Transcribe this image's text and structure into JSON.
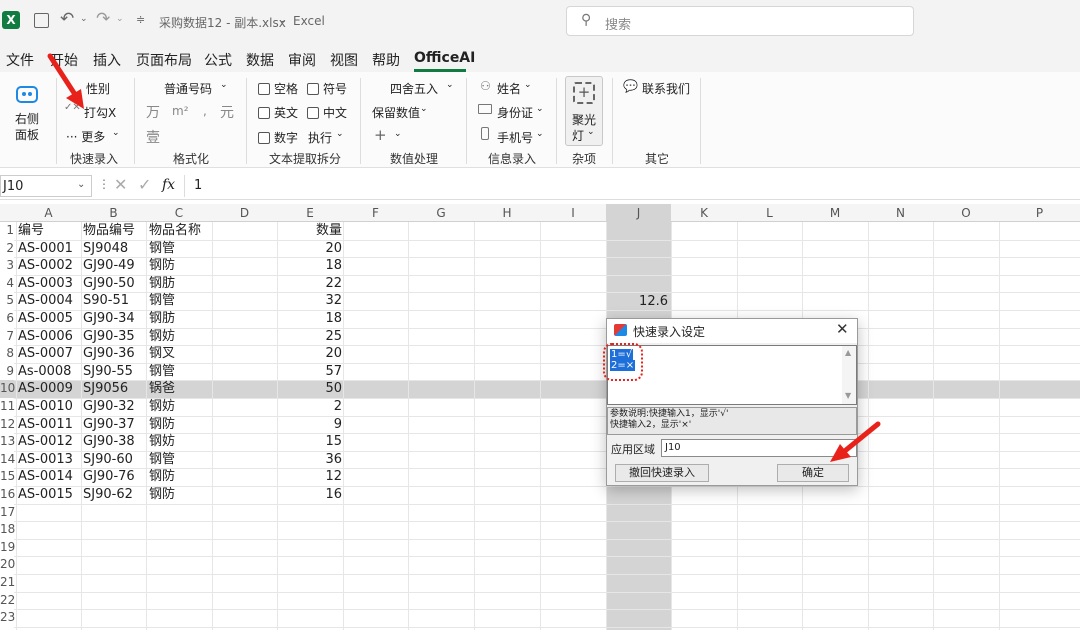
{
  "app": {
    "doc_title": "采购数据12 - 副本.xlsx",
    "separator": "-",
    "app_name": "Excel",
    "search_placeholder": "搜索",
    "logo_letter": "X"
  },
  "menu": [
    "文件",
    "开始",
    "插入",
    "页面布局",
    "公式",
    "数据",
    "审阅",
    "视图",
    "帮助",
    "OfficeAI"
  ],
  "ribbon": {
    "panel": {
      "line1": "右侧",
      "line2": "面板"
    },
    "quick": {
      "gender": "性别",
      "tick": "打勾X",
      "more": "··· 更多",
      "group": "快速录入"
    },
    "format": {
      "dropdown": "普通号码",
      "u1": "万",
      "u2": "m²",
      "u3": ",",
      "u4": "元",
      "u5": "壹",
      "group": "格式化"
    },
    "text": {
      "c1": "空格",
      "c2": "符号",
      "c3": "英文",
      "c4": "中文",
      "c5": "数字",
      "exec": "执行",
      "group": "文本提取拆分"
    },
    "number": {
      "round": "四舍五入",
      "keep": "保留数值",
      "plus": "+",
      "group": "数值处理"
    },
    "info": {
      "name": "姓名",
      "id": "身份证",
      "phone": "手机号",
      "group": "信息录入"
    },
    "misc": {
      "line1": "聚光",
      "line2": "灯",
      "group": "杂项"
    },
    "other": {
      "contact": "联系我们",
      "group": "其它"
    }
  },
  "formula": {
    "namebox": "J10",
    "fx": "fx",
    "value": "1"
  },
  "columns": [
    "A",
    "B",
    "C",
    "D",
    "E",
    "F",
    "G",
    "H",
    "I",
    "J",
    "K",
    "L",
    "M",
    "N",
    "O",
    "P"
  ],
  "row_numbers": [
    "1",
    "2",
    "3",
    "4",
    "5",
    "6",
    "7",
    "8",
    "9",
    "10",
    "11",
    "12",
    "13",
    "14",
    "15",
    "16",
    "17",
    "18",
    "19",
    "20",
    "21",
    "22",
    "23"
  ],
  "table": {
    "headers": [
      "编号",
      "物品编号",
      "物品名称",
      "数量"
    ],
    "rows": [
      [
        "AS-0001",
        "SJ9048",
        "钢管",
        "20"
      ],
      [
        "AS-0002",
        "GJ90-49",
        "钢防",
        "18"
      ],
      [
        "AS-0003",
        "GJ90-50",
        "钢肪",
        "22"
      ],
      [
        "AS-0004",
        "S90-51",
        "钢管",
        "32"
      ],
      [
        "AS-0005",
        "GJ90-34",
        "钢肪",
        "18"
      ],
      [
        "AS-0006",
        "GJ90-35",
        "钢妨",
        "25"
      ],
      [
        "AS-0007",
        "GJ90-36",
        "钢叉",
        "20"
      ],
      [
        "As-0008",
        "SJ90-55",
        "钢管",
        "57"
      ],
      [
        "AS-0009",
        "SJ9056",
        "锅爸",
        "50"
      ],
      [
        "AS-0010",
        "GJ90-32",
        "钢妨",
        "2"
      ],
      [
        "AS-0011",
        "GJ90-37",
        "钢防",
        "9"
      ],
      [
        "AS-0012",
        "GJ90-38",
        "钢妨",
        "15"
      ],
      [
        "AS-0013",
        "SJ90-60",
        "钢管",
        "36"
      ],
      [
        "AS-0014",
        "GJ90-76",
        "钢防",
        "12"
      ],
      [
        "AS-0015",
        "SJ90-62",
        "钢防",
        "16"
      ]
    ]
  },
  "j_cell_value": "12.6",
  "dialog": {
    "title": "快速录入设定",
    "line1": "1=√",
    "line2": "2=×",
    "help1": "参数说明:快捷输入1，显示'√'",
    "help2": "快捷输入2，显示'×'",
    "area_label": "应用区域",
    "area_value": "J10",
    "undo": "撤回快速录入",
    "ok": "确定"
  },
  "colors": {
    "accent": "#107c41",
    "selected_col": "#d4d4d4",
    "arrow": "#e8221b"
  }
}
